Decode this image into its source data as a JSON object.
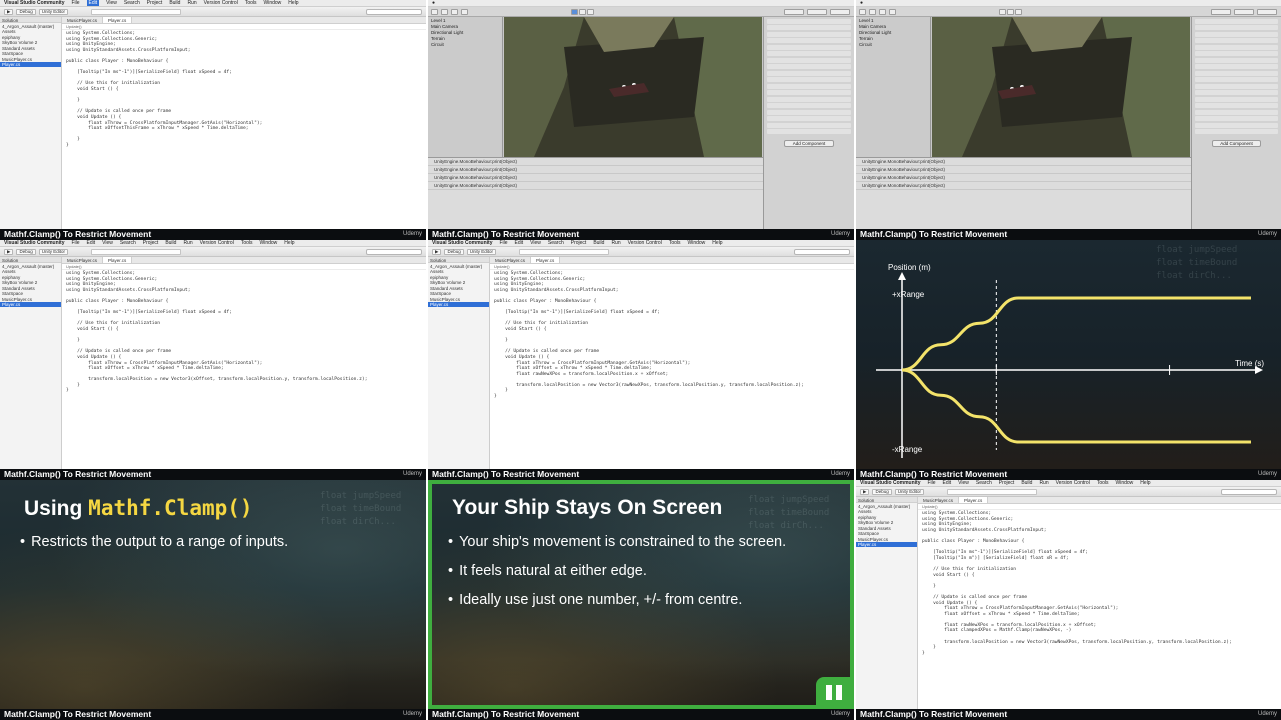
{
  "caption": "Mathf.Clamp() To Restrict Movement",
  "udemy_label": "Udemy",
  "colors": {
    "accent_yellow": "#f5d742",
    "green": "#3fae3f",
    "caption_bg": "#0b0d10"
  },
  "vs": {
    "app": "Visual Studio Community",
    "menus": [
      "File",
      "Edit",
      "View",
      "Search",
      "Project",
      "Build",
      "Run",
      "Version Control",
      "Tools",
      "Window",
      "Help"
    ],
    "debug": "Debug",
    "target": "Unity Editor",
    "solution_header": "Solution",
    "tree": [
      "4_Argon_Assault (master)",
      "Assets",
      "epiphany",
      "SkyBox Volume 2",
      "Standard Assets",
      "StarSpace",
      "MusicPlayer.cs",
      "Player.cs"
    ],
    "tabs": [
      "MusicPlayer.cs",
      "Player.cs"
    ],
    "crumb": "Update()",
    "code1": "using System.Collections;\nusing System.Collections.Generic;\nusing UnityEngine;\nusing UnityStandardAssets.CrossPlatformInput;\n\npublic class Player : MonoBehaviour {\n\n    [Tooltip(\"In ms^-1\")][SerializeField] float xSpeed = 4f;\n\n    // Use this for initialization\n    void Start () {\n\n    }\n\n    // Update is called once per frame\n    void Update () {\n        float xThrow = CrossPlatformInputManager.GetAxis(\"Horizontal\");\n        float xOffsetThisFrame = xThrow * xSpeed * Time.deltaTime;\n\n    }\n}",
    "code4": "using System.Collections;\nusing System.Collections.Generic;\nusing UnityEngine;\nusing UnityStandardAssets.CrossPlatformInput;\n\npublic class Player : MonoBehaviour {\n\n    [Tooltip(\"In ms^-1\")][SerializeField] float xSpeed = 4f;\n\n    // Use this for initialization\n    void Start () {\n\n    }\n\n    // Update is called once per frame\n    void Update () {\n        float xThrow = CrossPlatformInputManager.GetAxis(\"Horizontal\");\n        float xOffset = xThrow * xSpeed * Time.deltaTime;\n\n        transform.localPosition = new Vector3(xOffset, transform.localPosition.y, transform.localPosition.z);\n    }\n}",
    "code5": "using System.Collections;\nusing System.Collections.Generic;\nusing UnityEngine;\nusing UnityStandardAssets.CrossPlatformInput;\n\npublic class Player : MonoBehaviour {\n\n    [Tooltip(\"In ms^-1\")][SerializeField] float xSpeed = 4f;\n\n    // Use this for initialization\n    void Start () {\n\n    }\n\n    // Update is called once per frame\n    void Update () {\n        float xThrow = CrossPlatformInputManager.GetAxis(\"Horizontal\");\n        float xOffset = xThrow * xSpeed * Time.deltaTime;\n        float rawNewXPos = transform.localPosition.x + xOffset;\n\n        transform.localPosition = new Vector3(rawNewXPos, transform.localPosition.y, transform.localPosition.z);\n    }\n}",
    "code9": "using System.Collections;\nusing System.Collections.Generic;\nusing UnityEngine;\nusing UnityStandardAssets.CrossPlatformInput;\n\npublic class Player : MonoBehaviour {\n\n    [Tooltip(\"In ms^-1\")][SerializeField] float xSpeed = 4f;\n    [Tooltip(\"In m\")] [SerializeField] float xR = 4f;\n\n    // Use this for initialization\n    void Start () {\n\n    }\n\n    // Update is called once per frame\n    void Update () {\n        float xThrow = CrossPlatformInputManager.GetAxis(\"Horizontal\");\n        float xOffset = xThrow * xSpeed * Time.deltaTime;\n\n        float rawNewXPos = transform.localPosition.x + xOffset;\n        float clampedXPos = Mathf.Clamp(rawNewXPos, -)\n\n        transform.localPosition = new Vector3(rawNewXPos, transform.localPosition.y, transform.localPosition.z);\n    }\n}"
  },
  "unity": {
    "hierarchy": [
      "Level 1",
      "Main Camera",
      "Directional Light",
      "Terrain",
      "Circuit"
    ],
    "console_lines": [
      "UnityEngine.MonoBehaviour:print(Object)",
      "UnityEngine.MonoBehaviour:print(Object)",
      "UnityEngine.MonoBehaviour:print(Object)",
      "UnityEngine.MonoBehaviour:print(Object)"
    ],
    "add_component": "Add Component"
  },
  "chart_data": {
    "type": "line",
    "ylabel": "Position (m)",
    "xlabel": "Time (s)",
    "labels": [
      "+xRange",
      "-xRange"
    ],
    "series": [
      {
        "x": [
          0,
          1,
          2,
          3,
          4,
          6,
          9
        ],
        "y": [
          0,
          0.35,
          0.65,
          1,
          1,
          1,
          1
        ]
      },
      {
        "x": [
          0,
          1,
          2,
          3,
          4,
          6,
          9
        ],
        "y": [
          0,
          -0.35,
          -0.65,
          -1,
          -1,
          -1,
          -1
        ]
      }
    ],
    "ylim": [
      -1.3,
      1.3
    ],
    "xlim": [
      0,
      9
    ]
  },
  "slide1": {
    "title_prefix": "Using ",
    "title_code": "Mathf.Clamp()",
    "bullets": [
      "Restricts the output to a range of inputs."
    ]
  },
  "slide2": {
    "title": "Your Ship Stays On Screen",
    "bullets": [
      "Your ship's movement is constrained to the screen.",
      "It feels natural at either edge.",
      "Ideally use just one number, +/- from centre."
    ]
  }
}
